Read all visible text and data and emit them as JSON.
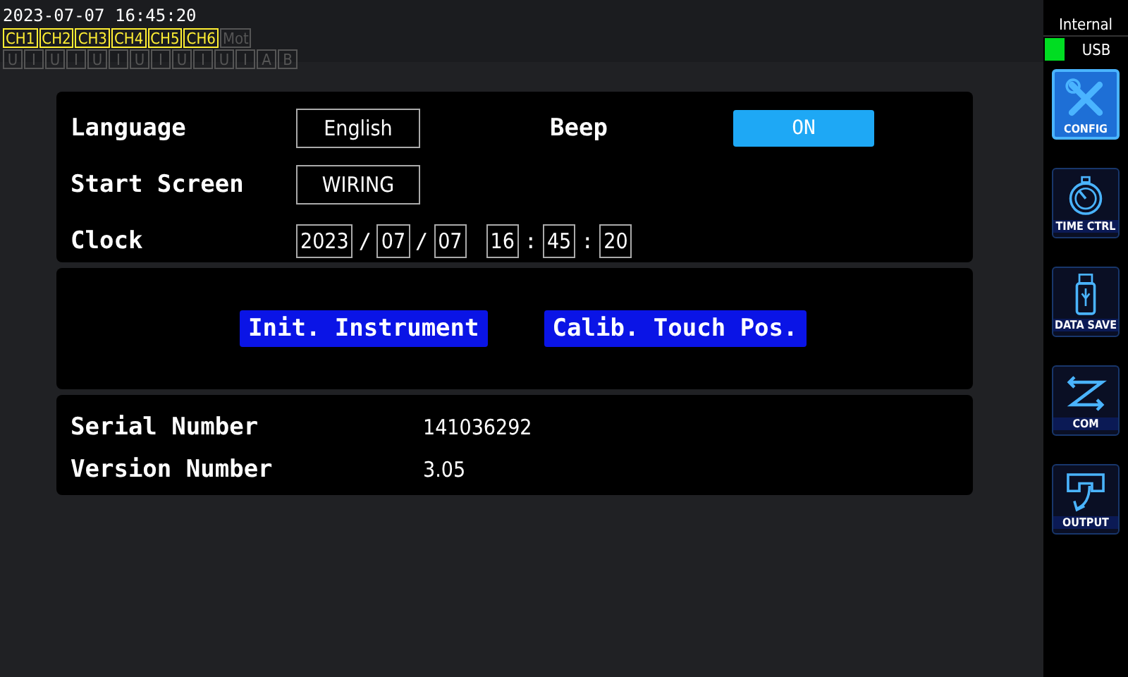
{
  "status_bar": {
    "datetime": "2023-07-07 16:45:20",
    "channels": [
      {
        "label": "CH1",
        "on": true
      },
      {
        "label": "CH2",
        "on": true
      },
      {
        "label": "CH3",
        "on": true
      },
      {
        "label": "CH4",
        "on": true
      },
      {
        "label": "CH5",
        "on": true
      },
      {
        "label": "CH6",
        "on": true
      },
      {
        "label": "Mot",
        "on": false
      }
    ],
    "inputs": [
      {
        "label": "U",
        "on": false
      },
      {
        "label": "I",
        "on": false
      },
      {
        "label": "U",
        "on": false
      },
      {
        "label": "I",
        "on": false
      },
      {
        "label": "U",
        "on": false
      },
      {
        "label": "I",
        "on": false
      },
      {
        "label": "U",
        "on": false
      },
      {
        "label": "I",
        "on": false
      },
      {
        "label": "U",
        "on": false
      },
      {
        "label": "I",
        "on": false
      },
      {
        "label": "U",
        "on": false
      },
      {
        "label": "I",
        "on": false
      },
      {
        "label": "A",
        "on": false
      },
      {
        "label": "B",
        "on": false
      }
    ]
  },
  "settings": {
    "language": {
      "label": "Language",
      "value": "English"
    },
    "beep": {
      "label": "Beep",
      "value": "ON",
      "on": true
    },
    "start_screen": {
      "label": "Start Screen",
      "value": "WIRING"
    },
    "clock": {
      "label": "Clock",
      "parts": [
        {
          "kind": "field",
          "text": "2023"
        },
        {
          "kind": "sep",
          "text": "/"
        },
        {
          "kind": "field",
          "text": "07"
        },
        {
          "kind": "sep",
          "text": "/"
        },
        {
          "kind": "field",
          "text": "07"
        },
        {
          "kind": "gap"
        },
        {
          "kind": "field",
          "text": "16"
        },
        {
          "kind": "sep",
          "text": ":"
        },
        {
          "kind": "field",
          "text": "45"
        },
        {
          "kind": "sep",
          "text": ":"
        },
        {
          "kind": "field",
          "text": "20"
        }
      ]
    }
  },
  "actions": [
    "Init. Instrument",
    "Calib. Touch Pos."
  ],
  "info": [
    {
      "label": "Serial Number",
      "value": "141036292"
    },
    {
      "label": "Version Number",
      "value": "3.05"
    }
  ],
  "sidebar": {
    "storage": "Internal",
    "media": {
      "label": "USB",
      "ready": true
    },
    "items": [
      {
        "label": "CONFIG",
        "selected": true
      },
      {
        "label": "TIME CTRL",
        "selected": false
      },
      {
        "label": "DATA SAVE",
        "selected": false
      },
      {
        "label": "COM",
        "selected": false
      },
      {
        "label": "OUTPUT",
        "selected": false
      }
    ]
  }
}
